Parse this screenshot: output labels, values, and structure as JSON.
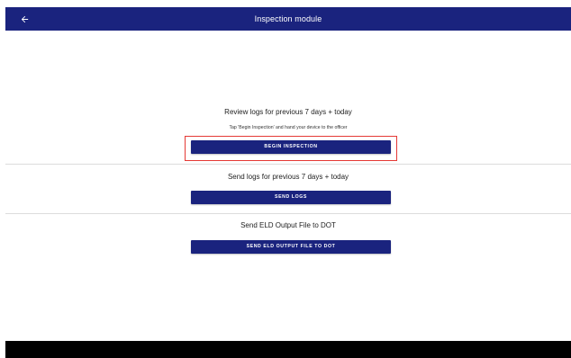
{
  "app_bar": {
    "title": "Inspection module",
    "back_icon": "arrow-left-icon"
  },
  "sections": [
    {
      "title": "Review logs for previous 7 days + today",
      "subtitle": "Tap 'Begin Inspection' and hand your device to the officer",
      "button_label": "BEGIN INSPECTION"
    },
    {
      "title": "Send logs for previous 7 days + today",
      "button_label": "SEND LOGS"
    },
    {
      "title": "Send ELD Output File to DOT",
      "button_label": "SEND ELD OUTPUT FILE TO DOT"
    }
  ],
  "colors": {
    "primary": "#1a237e",
    "highlight": "#e53935",
    "divider": "#dcdcdc",
    "nav_bar": "#000000"
  }
}
